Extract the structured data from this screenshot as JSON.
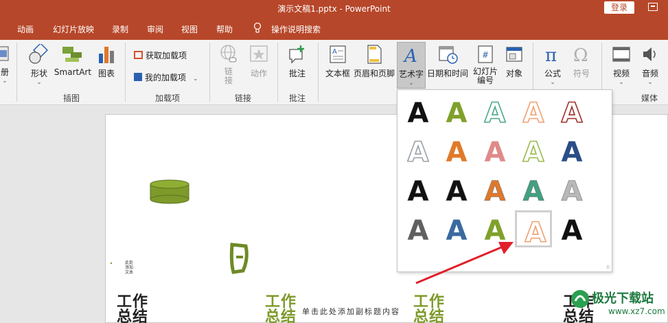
{
  "titlebar": {
    "title": "演示文稿1.pptx  -  PowerPoint",
    "login": "登录"
  },
  "menu": [
    "动画",
    "幻灯片放映",
    "录制",
    "审阅",
    "视图",
    "帮助",
    "操作说明搜索"
  ],
  "ribbon": {
    "partial_left": "册",
    "shapes": "形状",
    "smartart": "SmartArt",
    "chart": "图表",
    "group_illustrations": "插图",
    "get_addins": "获取加载项",
    "my_addins": "我的加载项",
    "group_addins": "加载项",
    "link_lines": [
      "链",
      "接"
    ],
    "action": "动作",
    "group_links": "链接",
    "comment": "批注",
    "group_comments": "批注",
    "textbox": "文本框",
    "header_footer": "页眉和页脚",
    "wordart": "艺术字",
    "datetime": "日期和时间",
    "slide_number_lines": [
      "幻灯片",
      "编号"
    ],
    "object": "对象",
    "equation": "公式",
    "symbol": "符号",
    "video": "视频",
    "audio": "音频",
    "group_media": "媒体"
  },
  "wordart_gallery": {
    "glyph": "A",
    "selected_index": 18,
    "colors": {
      "row1": [
        "#111111",
        "#7fa12a",
        "#4aa88a",
        "#f0a070",
        "#a0302a"
      ],
      "row2": [
        "#9aa0a8",
        "#e07a2a",
        "#e08a8a",
        "#9ab84a",
        "#2a4e86"
      ],
      "row3": [
        "#111111",
        "#111111",
        "#e0782a",
        "#40a080",
        "#b8b8b8"
      ],
      "row4": [
        "#606060",
        "#3a6aa0",
        "#7fa12a",
        "#f0a070",
        "#111111"
      ]
    }
  },
  "slide": {
    "title_left": [
      "工作",
      "总结"
    ],
    "title_mid": [
      "工作",
      "总结"
    ],
    "title_mid2": [
      "工作",
      "总结"
    ],
    "title_right": [
      "工作",
      "总结"
    ],
    "subtitle": "单击此处添加副标题内容",
    "tiny_lines": [
      "此处",
      "添加",
      "文本"
    ]
  },
  "watermark": {
    "text": "极光下载站",
    "url": "www.xz7.com"
  },
  "colors": {
    "brand": "#b7472a",
    "accent_green": "#7d9a2a",
    "arrow": "#e0202a"
  }
}
